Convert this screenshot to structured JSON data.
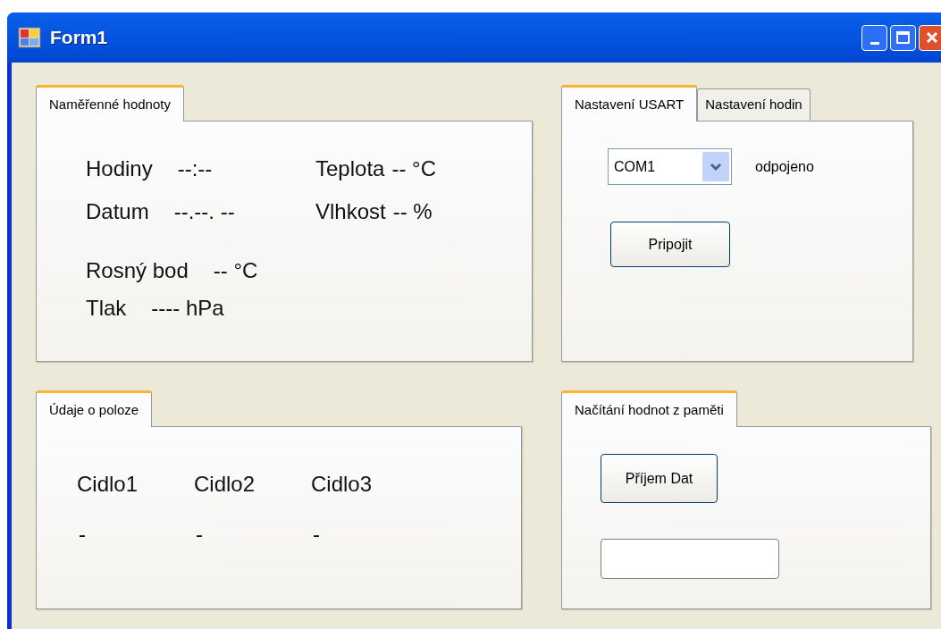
{
  "window": {
    "title": "Form1"
  },
  "measurements": {
    "tabs": [
      {
        "label": "Naměřenné hodnoty",
        "selected": true
      }
    ],
    "columns": [
      [
        {
          "label": "Hodiny",
          "value": "--:--"
        },
        {
          "label": "Datum",
          "value": "--.--. --"
        }
      ],
      [
        {
          "label": "Teplota",
          "value": "-- °C"
        },
        {
          "label": "Vlhkost",
          "value": "-- %"
        }
      ]
    ],
    "extra": [
      {
        "label": "Rosný bod",
        "value": "-- °C"
      },
      {
        "label": "Tlak",
        "value": "---- hPa"
      }
    ]
  },
  "usart": {
    "tabs": [
      {
        "label": "Nastavení USART",
        "selected": true
      },
      {
        "label": "Nastavení hodin",
        "selected": false
      }
    ],
    "port": "COM1",
    "status": "odpojeno",
    "connect_button": "Pripojit"
  },
  "position": {
    "tabs": [
      {
        "label": "Údaje o poloze",
        "selected": true
      }
    ],
    "sensors": [
      {
        "name": "Cidlo1",
        "value": "-"
      },
      {
        "name": "Cidlo2",
        "value": "-"
      },
      {
        "name": "Cidlo3",
        "value": "-"
      }
    ]
  },
  "memory": {
    "tabs": [
      {
        "label": "Načítání hodnot z paměti",
        "selected": true
      }
    ],
    "receive_button": "Příjem Dat"
  }
}
